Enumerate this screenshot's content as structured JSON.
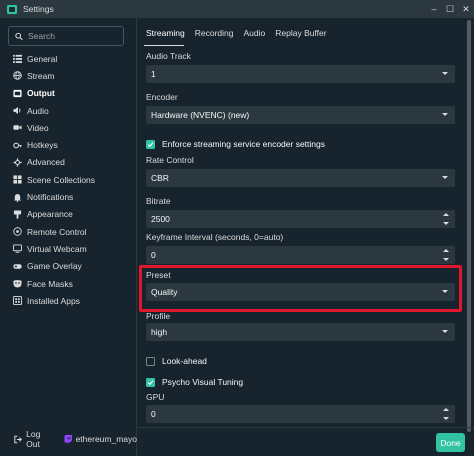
{
  "window": {
    "title": "Settings",
    "minimize": "–",
    "maximize": "☐",
    "close": "✕"
  },
  "colors": {
    "accent": "#31c3a2",
    "highlight": "#e0162e",
    "background": "#17242d",
    "control": "#2b383f"
  },
  "sidebar": {
    "search_placeholder": "Search",
    "items": [
      {
        "label": "General",
        "icon": "list-icon",
        "active": false
      },
      {
        "label": "Stream",
        "icon": "globe-icon",
        "active": false
      },
      {
        "label": "Output",
        "icon": "output-icon",
        "active": true
      },
      {
        "label": "Audio",
        "icon": "speaker-icon",
        "active": false
      },
      {
        "label": "Video",
        "icon": "video-icon",
        "active": false
      },
      {
        "label": "Hotkeys",
        "icon": "keyboard-icon",
        "active": false
      },
      {
        "label": "Advanced",
        "icon": "wrench-icon",
        "active": false
      },
      {
        "label": "Scene Collections",
        "icon": "grid-icon",
        "active": false
      },
      {
        "label": "Notifications",
        "icon": "bell-icon",
        "active": false
      },
      {
        "label": "Appearance",
        "icon": "brush-icon",
        "active": false
      },
      {
        "label": "Remote Control",
        "icon": "remote-icon",
        "active": false
      },
      {
        "label": "Virtual Webcam",
        "icon": "webcam-icon",
        "active": false
      },
      {
        "label": "Game Overlay",
        "icon": "gamepad-icon",
        "active": false
      },
      {
        "label": "Face Masks",
        "icon": "mask-icon",
        "active": false
      },
      {
        "label": "Installed Apps",
        "icon": "apps-icon",
        "active": false
      }
    ],
    "logout_label": "Log Out",
    "username": "ethereum_mayo"
  },
  "tabs": [
    {
      "label": "Streaming",
      "active": true
    },
    {
      "label": "Recording",
      "active": false
    },
    {
      "label": "Audio",
      "active": false
    },
    {
      "label": "Replay Buffer",
      "active": false
    }
  ],
  "fields": {
    "audio_track": {
      "label": "Audio Track",
      "value": "1"
    },
    "encoder": {
      "label": "Encoder",
      "value": "Hardware (NVENC) (new)"
    },
    "enforce": {
      "label": "Enforce streaming service encoder settings",
      "checked": true
    },
    "rate_control": {
      "label": "Rate Control",
      "value": "CBR"
    },
    "bitrate": {
      "label": "Bitrate",
      "value": "2500"
    },
    "keyframe": {
      "label": "Keyframe Interval (seconds, 0=auto)",
      "value": "0"
    },
    "preset": {
      "label": "Preset",
      "value": "Quality"
    },
    "profile": {
      "label": "Profile",
      "value": "high"
    },
    "lookahead": {
      "label": "Look-ahead",
      "checked": false
    },
    "psycho": {
      "label": "Psycho Visual Tuning",
      "checked": true
    },
    "gpu": {
      "label": "GPU",
      "value": "0"
    }
  },
  "done_label": "Done"
}
